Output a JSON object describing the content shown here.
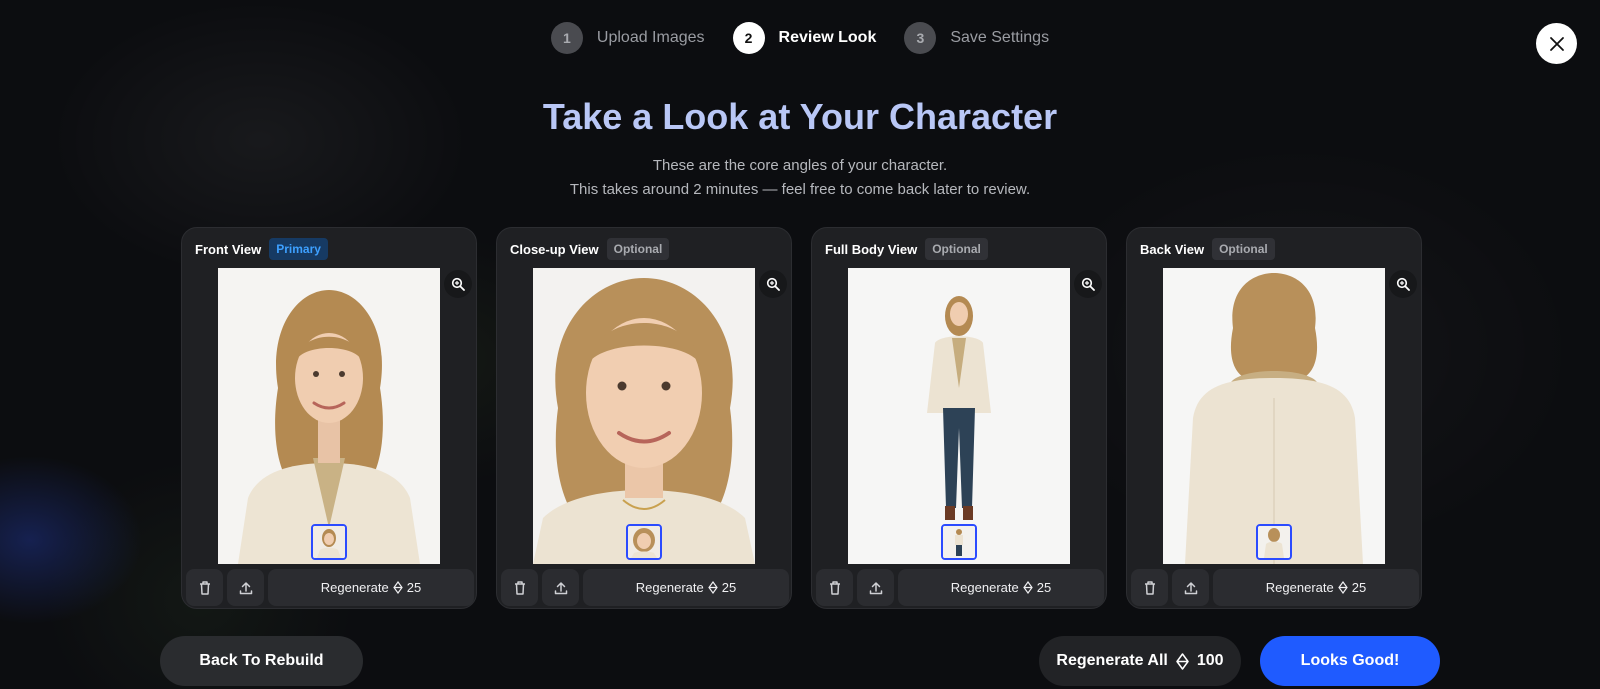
{
  "stepper": [
    {
      "num": "1",
      "label": "Upload Images"
    },
    {
      "num": "2",
      "label": "Review Look"
    },
    {
      "num": "3",
      "label": "Save Settings"
    }
  ],
  "heading": {
    "title": "Take a Look at Your Character",
    "subtitle_line1": "These are the core angles of your character.",
    "subtitle_line2": "This takes around 2 minutes — feel free to come back later to review."
  },
  "cards": [
    {
      "title": "Front View",
      "tag": "Primary",
      "regenerate_label": "Regenerate",
      "cost": "25"
    },
    {
      "title": "Close-up View",
      "tag": "Optional",
      "regenerate_label": "Regenerate",
      "cost": "25"
    },
    {
      "title": "Full Body View",
      "tag": "Optional",
      "regenerate_label": "Regenerate",
      "cost": "25"
    },
    {
      "title": "Back View",
      "tag": "Optional",
      "regenerate_label": "Regenerate",
      "cost": "25"
    }
  ],
  "footer": {
    "back_label": "Back To Rebuild",
    "regen_all_label": "Regenerate All",
    "regen_all_cost": "100",
    "confirm_label": "Looks Good!"
  },
  "icons": {
    "close": "close-icon",
    "zoom": "zoom-in-icon",
    "delete": "trash-icon",
    "upload": "upload-icon",
    "credit": "diamond-credit-icon"
  },
  "colors": {
    "accent": "#1f5bff",
    "title": "#b9c7f6",
    "primary_tag": "#3da0ff",
    "thumb_border": "#2b4bff"
  }
}
